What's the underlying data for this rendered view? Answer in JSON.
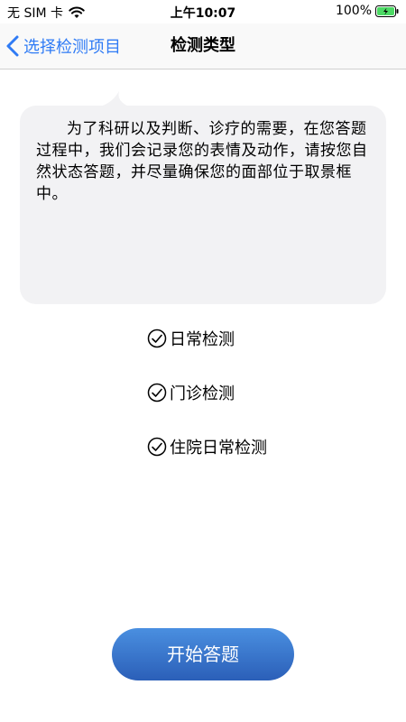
{
  "status_bar": {
    "carrier": "无 SIM 卡",
    "time": "上午10:07",
    "battery": "100%"
  },
  "nav": {
    "back_label": "选择检测项目",
    "title": "检测类型"
  },
  "notice": {
    "text": "为了科研以及判断、诊疗的需要，在您答题过程中，我们会记录您的表情及动作，请按您自然状态答题，并尽量确保您的面部位于取景框中。"
  },
  "options": [
    {
      "label": "日常检测",
      "icon": "check-circle-icon"
    },
    {
      "label": "门诊检测",
      "icon": "check-circle-icon"
    },
    {
      "label": "住院日常检测",
      "icon": "check-circle-icon"
    }
  ],
  "start_button": {
    "label": "开始答题"
  },
  "colors": {
    "accent": "#2f7bf5",
    "button_top": "#4a8fe0",
    "button_bottom": "#2b5fb8",
    "bubble_bg": "#f2f2f4",
    "battery_green": "#4cd964"
  }
}
